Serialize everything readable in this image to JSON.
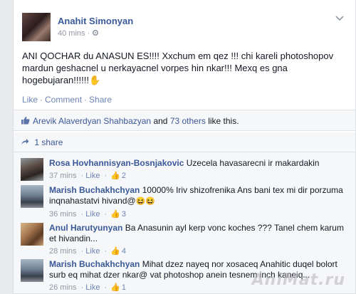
{
  "post": {
    "author": "Anahit Simonyan",
    "time": "40 mins",
    "privacy_separator": "·",
    "privacy_icon": "gear-icon",
    "menu_icon": "chevron-down-icon",
    "text": "ANI QOCHAR du ANASUN ES!!!! Xxchum em qez !!! chi kareli photoshopov mardun geshacnel u nerkayacnel vorpes hin nkar!!! Mexq es gna hogebujaran!!!!!!",
    "text_emoji": "✋",
    "actions": {
      "like": "Like",
      "comment": "Comment",
      "share": "Share",
      "separator": "·"
    }
  },
  "likes": {
    "icon": "thumbs-up-icon",
    "first_liker": "Arevik Alaverdyan Shahbazyan",
    "joiner": " and ",
    "others": "73 others",
    "suffix": " like this."
  },
  "shares": {
    "icon": "share-arrow-icon",
    "label": "1 share"
  },
  "comments": [
    {
      "author": "Rosa Hovhannisyan-Bosnjakovic",
      "text": "Uzecela havasarecni ir makardakin",
      "time": "37 mins",
      "like": "Like",
      "likes": "2"
    },
    {
      "author": "Marish Buchakhchyan",
      "text": "10000% Iriv shizofrenika Ans bani tex mi dir porzuma inqnahastatvi hivand@",
      "emoji": "😆😆",
      "time": "36 mins",
      "like": "Like",
      "likes": "3"
    },
    {
      "author": "Anul Harutyunyan",
      "text": "Ba Anasunin ayl kerp vonc koches ??? Tanel chem karum et hivandin...",
      "time": "28 mins",
      "like": "Like",
      "likes": "4"
    },
    {
      "author": "Marish Buchakhchyan",
      "text": "Mihat dzez nayeq nor xosaceq Anahitic duqel bolort surb eq mihat dzer nkar@ vat photoshop anein tesnem inch kaneiq...",
      "time": "26 mins",
      "like": "Like",
      "likes": "1"
    }
  ],
  "watermark": "AniMat.ru",
  "colors": {
    "link": "#3b5998",
    "muted": "#9197a3",
    "background": "#e9eaed",
    "panel": "#f6f7f8"
  }
}
